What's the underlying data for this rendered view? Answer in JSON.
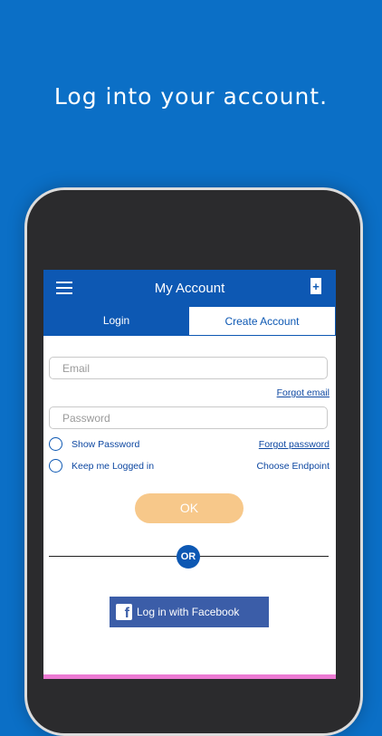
{
  "headline": "Log into your account.",
  "appbar": {
    "title": "My Account",
    "menu_icon": "hamburger-icon",
    "right_icon": "add-card-icon"
  },
  "tabs": [
    {
      "label": "Login",
      "active": true
    },
    {
      "label": "Create Account",
      "active": false
    }
  ],
  "form": {
    "email_placeholder": "Email",
    "forgot_email": "Forgot email",
    "password_placeholder": "Password",
    "show_password": "Show Password",
    "forgot_password": "Forgot password",
    "keep_logged_in": "Keep me Logged in",
    "choose_endpoint": "Choose Endpoint",
    "ok_label": "OK",
    "or_label": "OR",
    "facebook_label": "Log in with Facebook"
  },
  "colors": {
    "background": "#0b6fc6",
    "primary": "#0d58b3",
    "ok_button": "#f7c88a",
    "facebook": "#3b5da8"
  }
}
